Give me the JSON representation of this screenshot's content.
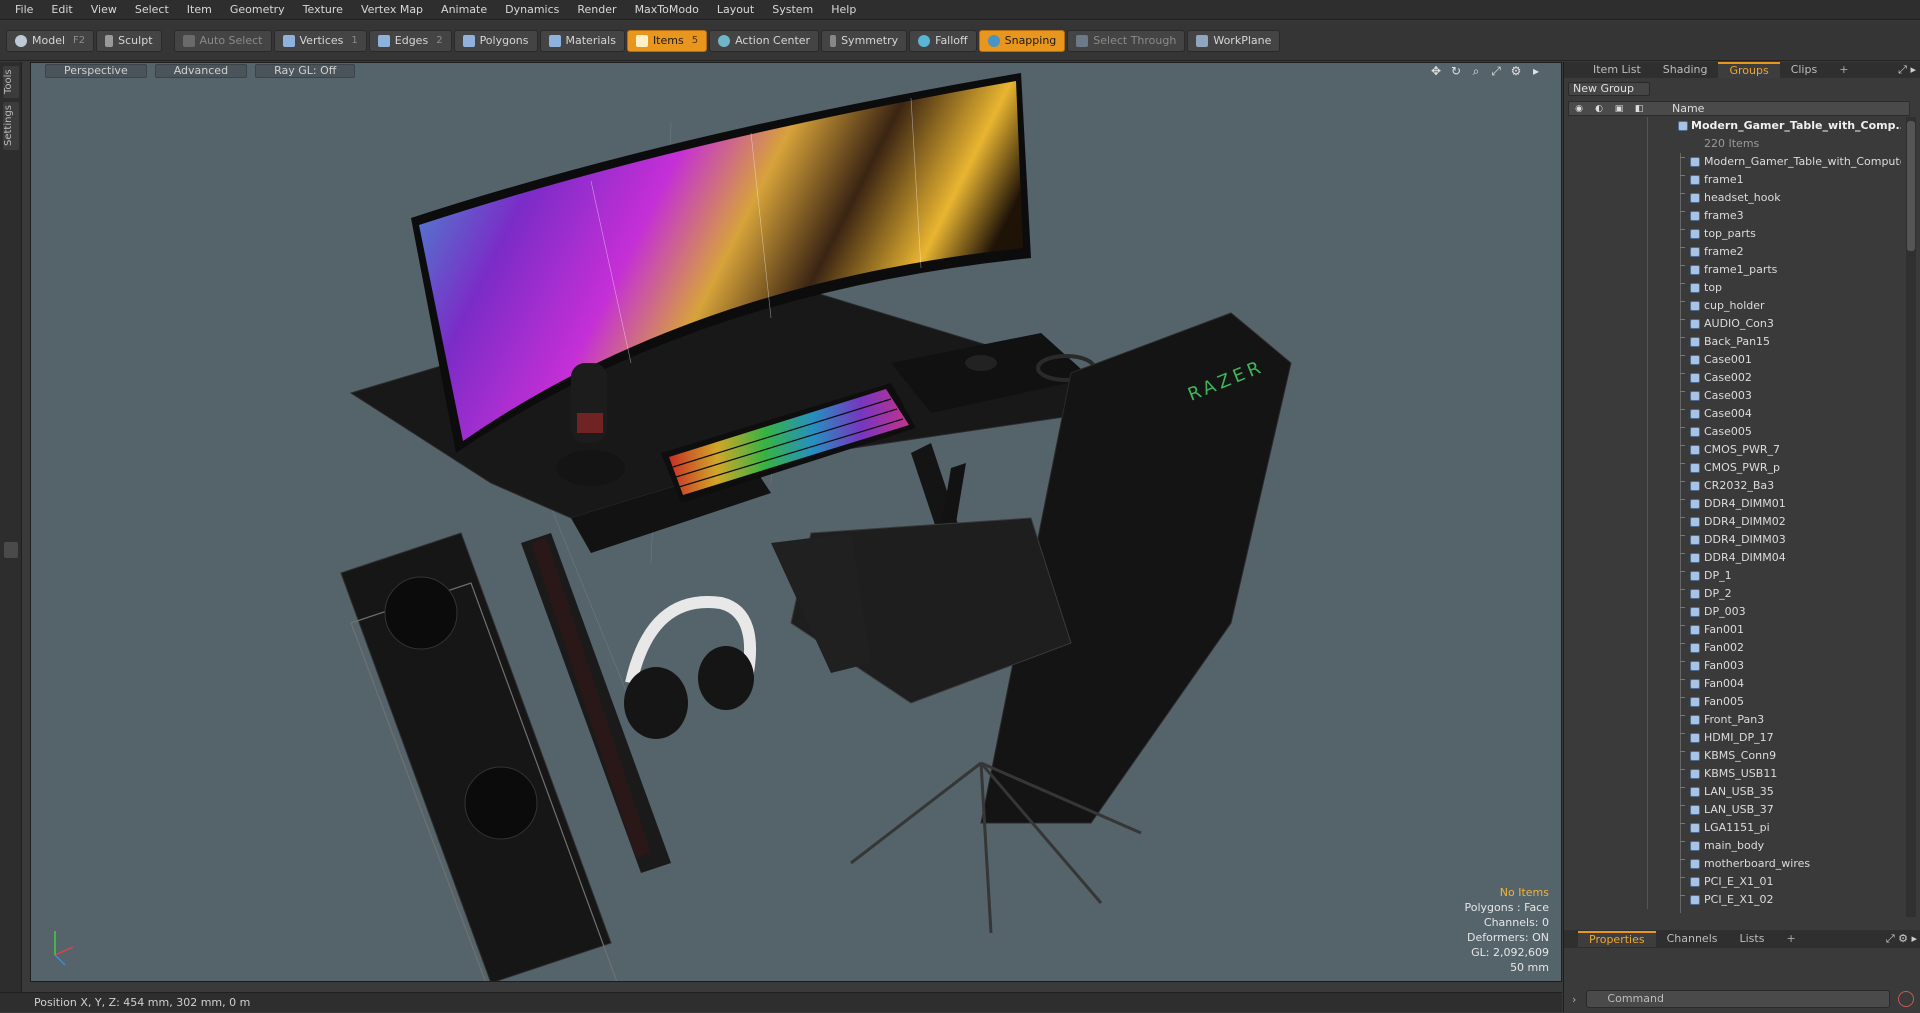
{
  "menu": [
    "File",
    "Edit",
    "View",
    "Select",
    "Item",
    "Geometry",
    "Texture",
    "Vertex Map",
    "Animate",
    "Dynamics",
    "Render",
    "MaxToModo",
    "Layout",
    "System",
    "Help"
  ],
  "toolbar": {
    "model": "Model",
    "model_key": "F2",
    "sculpt": "Sculpt",
    "auto_select": "Auto Select",
    "vertices": "Vertices",
    "vertices_key": "1",
    "edges": "Edges",
    "edges_key": "2",
    "polygons": "Polygons",
    "materials": "Materials",
    "items": "Items",
    "items_key": "5",
    "action_center": "Action Center",
    "symmetry": "Symmetry",
    "falloff": "Falloff",
    "snapping": "Snapping",
    "select_through": "Select Through",
    "workplane": "WorkPlane"
  },
  "left_tabs": {
    "tools": "Tools",
    "settings": "Settings"
  },
  "viewport": {
    "perspective": "Perspective",
    "advanced": "Advanced",
    "raygl": "Ray GL: Off",
    "monitor_brand": "RAZER",
    "info": {
      "no_items": "No Items",
      "polygons": "Polygons : Face",
      "channels": "Channels: 0",
      "deformers": "Deformers: ON",
      "gl": "GL: 2,092,609",
      "scale": "50 mm"
    }
  },
  "status": {
    "position": "Position X, Y, Z:  454 mm, 302 mm, 0 m"
  },
  "right_panel": {
    "tabs": [
      "Item List",
      "Shading",
      "Groups",
      "Clips",
      "+"
    ],
    "active_tab": "Groups",
    "new_group": "New Group",
    "column_name": "Name",
    "root": {
      "label": "Modern_Gamer_Table_with_Comp...",
      "count": "220 Items"
    },
    "items": [
      "Modern_Gamer_Table_with_Computer",
      "frame1",
      "headset_hook",
      "frame3",
      "top_parts",
      "frame2",
      "frame1_parts",
      "top",
      "cup_holder",
      "AUDIO_Con3",
      "Back_Pan15",
      "Case001",
      "Case002",
      "Case003",
      "Case004",
      "Case005",
      "CMOS_PWR_7",
      "CMOS_PWR_p",
      "CR2032_Ba3",
      "DDR4_DIMM01",
      "DDR4_DIMM02",
      "DDR4_DIMM03",
      "DDR4_DIMM04",
      "DP_1",
      "DP_2",
      "DP_003",
      "Fan001",
      "Fan002",
      "Fan003",
      "Fan004",
      "Fan005",
      "Front_Pan3",
      "HDMI_DP_17",
      "KBMS_Conn9",
      "KBMS_USB11",
      "LAN_USB_35",
      "LAN_USB_37",
      "LGA1151_pi",
      "main_body",
      "motherboard_wires",
      "PCI_E_X1_01",
      "PCI_E_X1_02"
    ],
    "bottom_tabs": [
      "Properties",
      "Channels",
      "Lists",
      "+"
    ],
    "command_placeholder": "Command"
  }
}
